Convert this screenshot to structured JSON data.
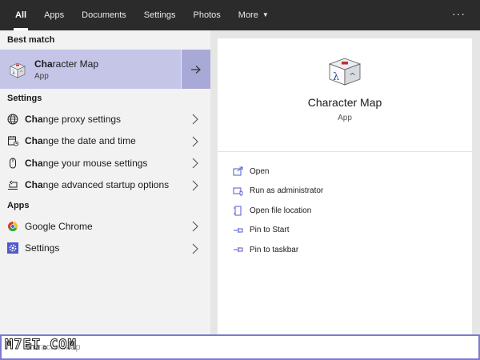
{
  "tabs": [
    {
      "label": "All"
    },
    {
      "label": "Apps"
    },
    {
      "label": "Documents"
    },
    {
      "label": "Settings"
    },
    {
      "label": "Photos"
    },
    {
      "label": "More"
    }
  ],
  "topbar": {
    "overflow": "···"
  },
  "sections": {
    "best_match": "Best match",
    "settings": "Settings",
    "apps": "Apps"
  },
  "best_match": {
    "title_bold": "Cha",
    "title_rest": "racter Map",
    "subtitle": "App"
  },
  "settings_items": [
    {
      "bold": "Cha",
      "rest": "nge proxy settings",
      "icon": "globe-icon"
    },
    {
      "bold": "Cha",
      "rest": "nge the date and time",
      "icon": "calendar-icon"
    },
    {
      "bold": "Cha",
      "rest": "nge your mouse settings",
      "icon": "mouse-icon"
    },
    {
      "bold": "Cha",
      "rest": "nge advanced startup options",
      "icon": "recovery-icon"
    }
  ],
  "app_items": [
    {
      "label": "Google Chrome",
      "icon": "chrome-icon"
    },
    {
      "label": "Settings",
      "icon": "gear-icon"
    }
  ],
  "detail": {
    "name": "Character Map",
    "type": "App"
  },
  "actions": [
    {
      "label": "Open",
      "icon": "open-icon"
    },
    {
      "label": "Run as administrator",
      "icon": "shield-icon"
    },
    {
      "label": "Open file location",
      "icon": "folder-icon"
    },
    {
      "label": "Pin to Start",
      "icon": "pin-icon"
    },
    {
      "label": "Pin to taskbar",
      "icon": "pin-icon"
    }
  ],
  "search": {
    "query": "cha",
    "placeholder_rest": "racter Map"
  },
  "watermark": "M7ET.COM",
  "colors": {
    "topbar": "#2b2b2b",
    "selection": "#c5c5e8",
    "accent": "#7b7bd0"
  }
}
